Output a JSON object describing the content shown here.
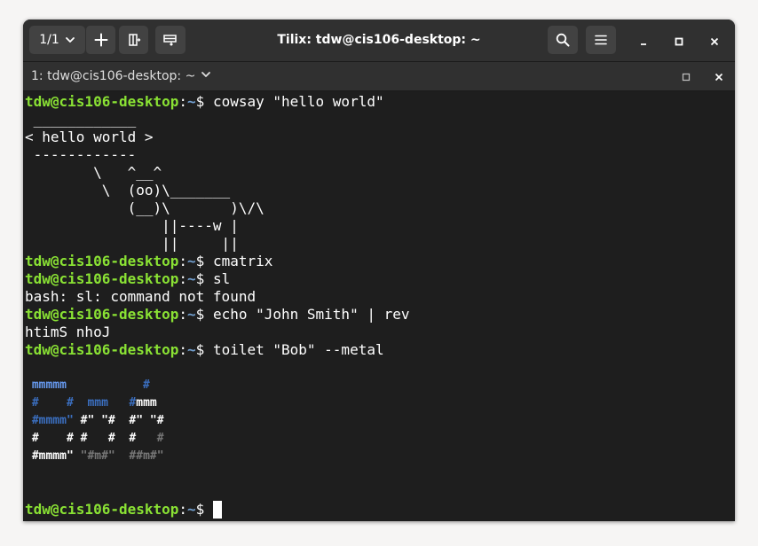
{
  "titlebar": {
    "session_count": "1/1",
    "title": "Tilix: tdw@cis106-desktop: ~"
  },
  "tab": {
    "label": "1: tdw@cis106-desktop: ~"
  },
  "prompt": {
    "user_host": "tdw@cis106-desktop",
    "colon": ":",
    "path": "~",
    "sym": "$ "
  },
  "terminal": {
    "cmd1": "cowsay \"hello world\"",
    "cow": [
      " ____________",
      "< hello world >",
      " ------------",
      "        \\   ^__^",
      "         \\  (oo)\\_______",
      "            (__)\\       )\\/\\",
      "                ||----w |",
      "                ||     ||"
    ],
    "cmd2": "cmatrix",
    "cmd3": "sl",
    "out3": "bash: sl: command not found",
    "cmd4": "echo \"John Smith\" | rev",
    "out4": "htimS nhoJ",
    "cmd5": "toilet \"Bob\" --metal",
    "toilet": {
      "r1a": "mmmmm",
      "r1b": "           #",
      "r2a": "#    #  ",
      "r2b": "mmm   ",
      "r2c": "#",
      "r2d": "mmm",
      "r3a": "#mmmm\"",
      "r3b": " #\" \"#  #\" \"#",
      "r4a": "#    # #   #  #   ",
      "r4b": "#",
      "r5a": "#mmmm\" ",
      "r5b": "\"#m#\"  ##m#\""
    }
  },
  "colors": {
    "prompt_user": "#8ae234",
    "prompt_path": "#729fcf",
    "background": "#1e1e1e",
    "headerbar": "#303030"
  },
  "icons": [
    "chevron-down-icon",
    "add-icon",
    "split-horizontal-icon",
    "split-vertical-icon",
    "search-icon",
    "hamburger-menu-icon",
    "minimize-icon",
    "maximize-icon",
    "close-icon"
  ]
}
